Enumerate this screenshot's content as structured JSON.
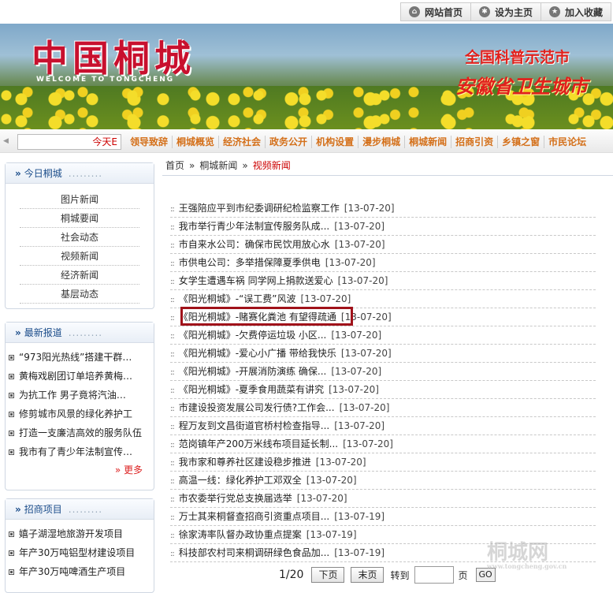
{
  "toplinks": [
    {
      "label": "网站首页",
      "icon": "home-icon"
    },
    {
      "label": "设为主页",
      "icon": "settings-icon"
    },
    {
      "label": "加入收藏",
      "icon": "bookmark-icon"
    }
  ],
  "banner": {
    "title": "中国桐城",
    "subtitle": "WELCOME TO TONGCHENG",
    "slogan1": "全国科普示范市",
    "slogan2": "安徽省卫生城市"
  },
  "nav": {
    "ticker": "今天E",
    "items": [
      "领导致辞",
      "桐城概览",
      "经济社会",
      "政务公开",
      "机构设置",
      "漫步桐城",
      "桐城新闻",
      "招商引资",
      "乡镇之窗",
      "市民论坛"
    ]
  },
  "sidebar": {
    "today": {
      "title": "今日桐城",
      "items": [
        "图片新闻",
        "桐城要闻",
        "社会动态",
        "视频新闻",
        "经济新闻",
        "基层动态"
      ]
    },
    "latest": {
      "title": "最新报道",
      "items": [
        "“973阳光热线”搭建干群…",
        "黄梅戏剧团订单培养黄梅…",
        "为抗工作 男子竟将汽油…",
        "修剪城市风景的绿化养护工",
        "打造一支廉洁高效的服务队伍",
        "我市有了青少年法制宣传…"
      ],
      "more": "更多"
    },
    "invest": {
      "title": "招商项目",
      "items": [
        "嬉子湖湿地旅游开发项目",
        "年产30万吨铝型材建设项目",
        "年产30万吨啤酒生产项目"
      ]
    }
  },
  "breadcrumb": {
    "home": "首页",
    "section": "桐城新闻",
    "current": "视频新闻"
  },
  "articles": [
    {
      "title": "王强陪应平到市纪委调研纪检监察工作",
      "date": "[13-07-20]"
    },
    {
      "title": "我市举行青少年法制宣传服务队成...",
      "date": "[13-07-20]"
    },
    {
      "title": "市自来水公司：确保市民饮用放心水",
      "date": "[13-07-20]"
    },
    {
      "title": "市供电公司：多举措保障夏季供电",
      "date": "[13-07-20]"
    },
    {
      "title": "女学生遭遇车祸 同学网上捐款送爱心",
      "date": "[13-07-20]"
    },
    {
      "title": "《阳光桐城》-“误工费”风波",
      "date": "[13-07-20]"
    },
    {
      "title": "《阳光桐城》-赌赛化粪池 有望得疏通",
      "date": "[13-07-20]"
    },
    {
      "title": "《阳光桐城》-欠费停运垃圾 小区...",
      "date": "[13-07-20]"
    },
    {
      "title": "《阳光桐城》-爱心小广播 带给我快乐",
      "date": "[13-07-20]"
    },
    {
      "title": "《阳光桐城》-开展消防演练 确保...",
      "date": "[13-07-20]"
    },
    {
      "title": "《阳光桐城》-夏季食用蔬菜有讲究",
      "date": "[13-07-20]"
    },
    {
      "title": "市建设投资发展公司发行债?工作会...",
      "date": "[13-07-20]"
    },
    {
      "title": "程万友到文昌街道官桥村检查指导...",
      "date": "[13-07-20]"
    },
    {
      "title": "范岗镇年产200万米线布项目延长制...",
      "date": "[13-07-20]"
    },
    {
      "title": "我市家和尊养社区建设稳步推进",
      "date": "[13-07-20]"
    },
    {
      "title": "高温一线：绿化养护工邓双全",
      "date": "[13-07-20]"
    },
    {
      "title": "市农委举行党总支换届选举",
      "date": "[13-07-20]"
    },
    {
      "title": "万士其来桐督查招商引资重点项目...",
      "date": "[13-07-19]"
    },
    {
      "title": "徐家涛率队督办政协重点提案",
      "date": "[13-07-19]"
    },
    {
      "title": "科技部农村司来桐调研绿色食品加...",
      "date": "[13-07-19]"
    }
  ],
  "pager": {
    "current": "1/20",
    "next": "下页",
    "last": "末页",
    "goto_label": "转到",
    "page_unit": "页",
    "go": "GO"
  },
  "watermark": {
    "text": "桐城网",
    "sub": "www.tongcheng.gov.cn"
  },
  "colors": {
    "accent_red": "#c00000",
    "nav_orange": "#d4701a",
    "sidebar_blue": "#1a4c8a",
    "highlight_box": "#a0121a"
  }
}
